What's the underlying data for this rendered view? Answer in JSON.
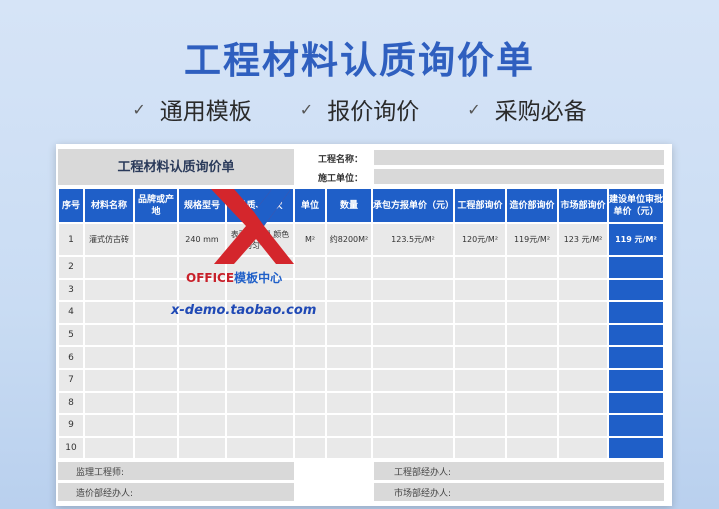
{
  "hero": {
    "title": "工程材料认质询价单",
    "tags": [
      "通用模板",
      "报价询价",
      "采购必备"
    ]
  },
  "sheet": {
    "title": "工程材料认质询价单",
    "project_name_label": "工程名称：",
    "construction_unit_label": "施工单位：",
    "headers": [
      "序号",
      "材料名称",
      "品牌或产地",
      "规格型号",
      "品质、档次",
      "单位",
      "数量",
      "承包方报单价（元）",
      "工程部询价",
      "造价部询价",
      "市场部询价",
      "建设单位审批单价（元）"
    ],
    "row1": {
      "seq": "1",
      "material": "灌式仿古砖",
      "brand": "",
      "spec": "240 mm",
      "quality": "表面无起翘 颜色均匀一致",
      "unit": "M²",
      "quantity": "约8200M²",
      "contractor_price": "123.5元/M²",
      "eng_price": "120元/M²",
      "cost_price": "119元/M²",
      "market_price": "123  元/M²",
      "approved_price": "119 元/M²"
    },
    "seqs": [
      "2",
      "3",
      "4",
      "5",
      "6",
      "7",
      "8",
      "9",
      "10"
    ],
    "footer": {
      "supervisor": "监理工程师:",
      "cost_handler": "造价部经办人:",
      "eng_handler": "工程部经办人:",
      "market_handler": "市场部经办人:"
    }
  },
  "watermark": {
    "brand_red": "OFFICE",
    "brand_blue": "模板中心",
    "url": "x-demo.taobao.com",
    "logo_colors": {
      "red": "#d4262c",
      "blue": "#1f5fc8"
    }
  }
}
